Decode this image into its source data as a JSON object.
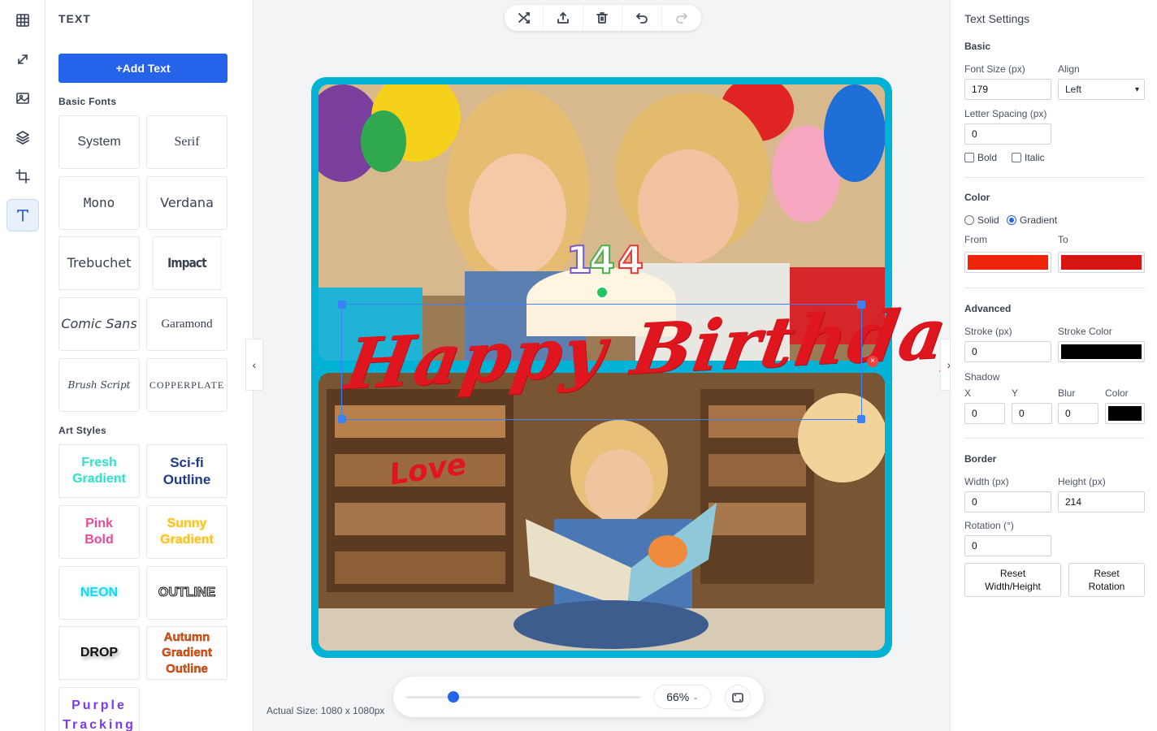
{
  "rail": {
    "items": [
      {
        "icon": "grid-icon"
      },
      {
        "icon": "resize-icon"
      },
      {
        "icon": "image-icon"
      },
      {
        "icon": "layers-icon"
      },
      {
        "icon": "crop-icon"
      },
      {
        "icon": "text-icon",
        "active": true
      }
    ]
  },
  "left_panel": {
    "title": "TEXT",
    "add_text_label": "+Add Text",
    "basic_fonts_label": "Basic Fonts",
    "basic_fonts": [
      "System",
      "Serif",
      "Mono",
      "Verdana",
      "Trebuchet",
      "Impact",
      "Comic Sans",
      "Garamond",
      "Brush Script",
      "COPPERPLATE"
    ],
    "art_styles_label": "Art Styles",
    "art_styles": [
      "Fresh Gradient",
      "Sci-fi Outline",
      "Pink Bold",
      "Sunny Gradient",
      "NEON",
      "OUTLINE",
      "DROP",
      "Autumn Gradient Outline",
      "Purple Tracking"
    ]
  },
  "canvas": {
    "text_main": "Happy Birthday",
    "text_secondary": "Love",
    "frame_color": "#00b2d6",
    "text_color": "#e0161e",
    "zoom": "66%",
    "zoom_fraction": 0.2,
    "actual_size": "Actual Size: 1080 x 1080px"
  },
  "text_settings": {
    "title": "Text Settings",
    "basic_label": "Basic",
    "font_size_label": "Font Size (px)",
    "font_size": "179",
    "align_label": "Align",
    "align": "Left",
    "letter_spacing_label": "Letter Spacing (px)",
    "letter_spacing": "0",
    "bold_label": "Bold",
    "italic_label": "Italic",
    "color_label": "Color",
    "solid_label": "Solid",
    "gradient_label": "Gradient",
    "from_label": "From",
    "to_label": "To",
    "from_color": "#f0230b",
    "to_color": "#d71515",
    "advanced_label": "Advanced",
    "stroke_label": "Stroke (px)",
    "stroke": "0",
    "stroke_color_label": "Stroke Color",
    "stroke_color": "#000000",
    "shadow_label": "Shadow",
    "shadow_x_label": "X",
    "shadow_y_label": "Y",
    "shadow_blur_label": "Blur",
    "shadow_color_label": "Color",
    "shadow_x": "0",
    "shadow_y": "0",
    "shadow_blur": "0",
    "shadow_color": "#000000",
    "border_label": "Border",
    "width_label": "Width (px)",
    "width": "0",
    "height_label": "Height (px)",
    "height": "214",
    "rotation_label": "Rotation (°)",
    "rotation": "0",
    "reset_wh_label": "Reset Width/Height",
    "reset_rotation_label": "Reset Rotation"
  }
}
